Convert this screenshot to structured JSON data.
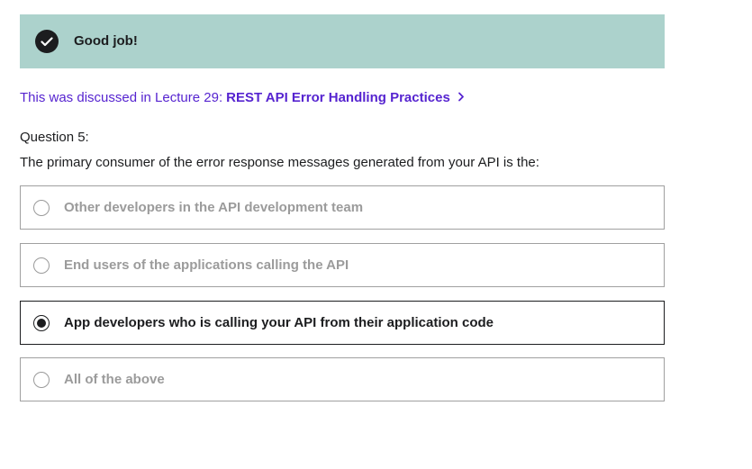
{
  "banner": {
    "message": "Good job!",
    "icon": "check-circle-icon",
    "background": "#acd2cc"
  },
  "lecture": {
    "prefix": "This was discussed in Lecture 29:",
    "link_label": "REST API Error Handling Practices",
    "icon": "chevron-right-icon",
    "color": "#5624d0"
  },
  "question": {
    "number_label": "Question 5:",
    "text": "The primary consumer of the error response messages generated from your API is the:"
  },
  "options": [
    {
      "label": "Other developers in the API development team",
      "selected": false
    },
    {
      "label": "End users of the applications calling the API",
      "selected": false
    },
    {
      "label": "App developers who is calling your API from their application code",
      "selected": true
    },
    {
      "label": "All of the above",
      "selected": false
    }
  ]
}
